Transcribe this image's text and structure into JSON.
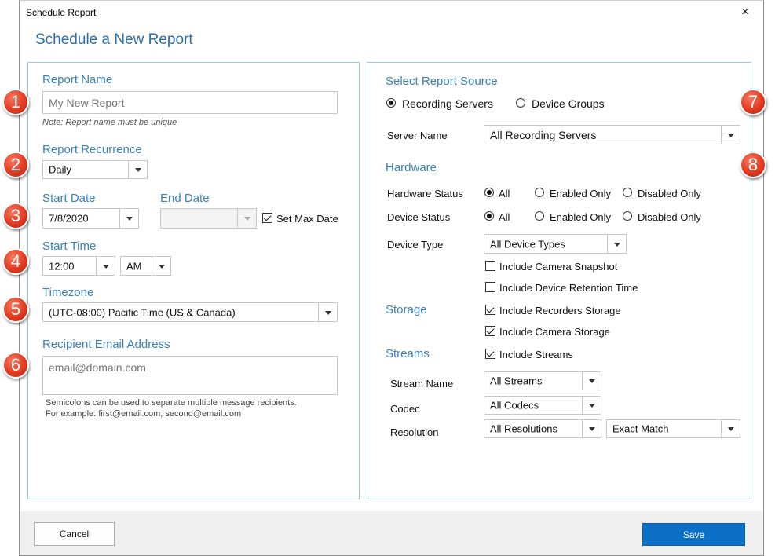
{
  "window": {
    "title": "Schedule Report",
    "close_icon": "×"
  },
  "heading": "Schedule a New Report",
  "left": {
    "report_name": {
      "label": "Report Name",
      "placeholder": "My New Report",
      "note": "Note: Report name must be unique"
    },
    "recurrence": {
      "label": "Report Recurrence",
      "value": "Daily"
    },
    "start_date": {
      "label": "Start Date",
      "value": "7/8/2020"
    },
    "end_date": {
      "label": "End Date",
      "value": ""
    },
    "set_max_date": {
      "label": "Set Max Date",
      "checked": true
    },
    "start_time": {
      "label": "Start Time",
      "time": "12:00",
      "ampm": "AM"
    },
    "timezone": {
      "label": "Timezone",
      "value": "(UTC-08:00) Pacific Time (US & Canada)"
    },
    "recipient": {
      "label": "Recipient Email Address",
      "placeholder": "email@domain.com",
      "hint1": "Semicolons can be used to separate multiple message recipients.",
      "hint2": "For example: first@email.com; second@email.com"
    }
  },
  "right": {
    "source": {
      "label": "Select Report Source",
      "recording_servers": "Recording Servers",
      "device_groups": "Device Groups",
      "selected": "recording_servers"
    },
    "server_name": {
      "label": "Server Name",
      "value": "All Recording Servers"
    },
    "hardware": {
      "label": "Hardware",
      "hardware_status": {
        "label": "Hardware Status",
        "all": "All",
        "enabled": "Enabled Only",
        "disabled": "Disabled Only"
      },
      "device_status": {
        "label": "Device Status",
        "all": "All",
        "enabled": "Enabled Only",
        "disabled": "Disabled Only"
      },
      "device_type": {
        "label": "Device Type",
        "value": "All Device Types"
      },
      "include_snapshot": "Include Camera Snapshot",
      "include_retention": "Include Device Retention Time"
    },
    "storage": {
      "label": "Storage",
      "recorders": "Include Recorders Storage",
      "camera": "Include Camera Storage"
    },
    "streams": {
      "label": "Streams",
      "include": "Include Streams",
      "stream_name": {
        "label": "Stream Name",
        "value": "All Streams"
      },
      "codec": {
        "label": "Codec",
        "value": "All Codecs"
      },
      "resolution": {
        "label": "Resolution",
        "value": "All Resolutions",
        "match": "Exact Match"
      }
    }
  },
  "footer": {
    "cancel": "Cancel",
    "save": "Save"
  },
  "badges": [
    "1",
    "2",
    "3",
    "4",
    "5",
    "6",
    "7",
    "8"
  ],
  "colors": {
    "accent": "#3b82b8",
    "save_button": "#0c70c7",
    "badge": "#e23b22",
    "panel_border": "#9ccbd6"
  }
}
